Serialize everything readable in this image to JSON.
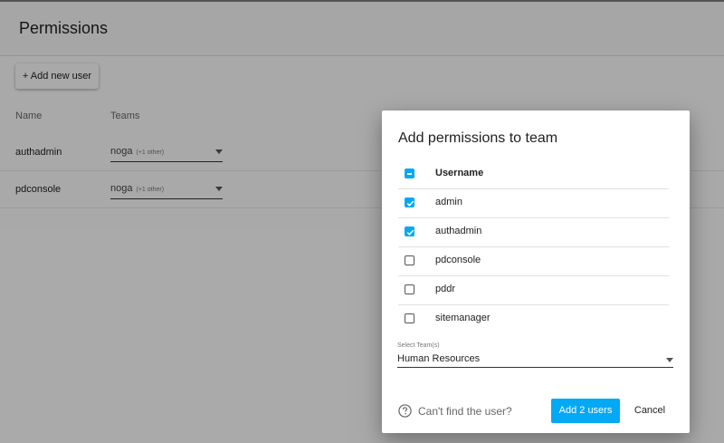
{
  "page": {
    "title": "Permissions",
    "add_user_label": "+ Add new user",
    "columns": {
      "name": "Name",
      "teams": "Teams"
    },
    "users": [
      {
        "name": "authadmin",
        "team": "noga",
        "team_more": "(+1 other)"
      },
      {
        "name": "pdconsole",
        "team": "noga",
        "team_more": "(+1 other)"
      }
    ]
  },
  "dialog": {
    "title": "Add permissions to team",
    "header_label": "Username",
    "header_checkbox_state": "indeterminate",
    "users": [
      {
        "label": "admin",
        "checked": true
      },
      {
        "label": "authadmin",
        "checked": true
      },
      {
        "label": "pdconsole",
        "checked": false
      },
      {
        "label": "pddr",
        "checked": false
      },
      {
        "label": "sitemanager",
        "checked": false
      }
    ],
    "select_label": "Select Team(s)",
    "select_value": "Human Resources",
    "help_text": "Can't find the user?",
    "primary_label": "Add 2 users",
    "cancel_label": "Cancel"
  },
  "colors": {
    "accent": "#03a9f4",
    "overlay": "rgba(0,0,0,0.32)"
  }
}
